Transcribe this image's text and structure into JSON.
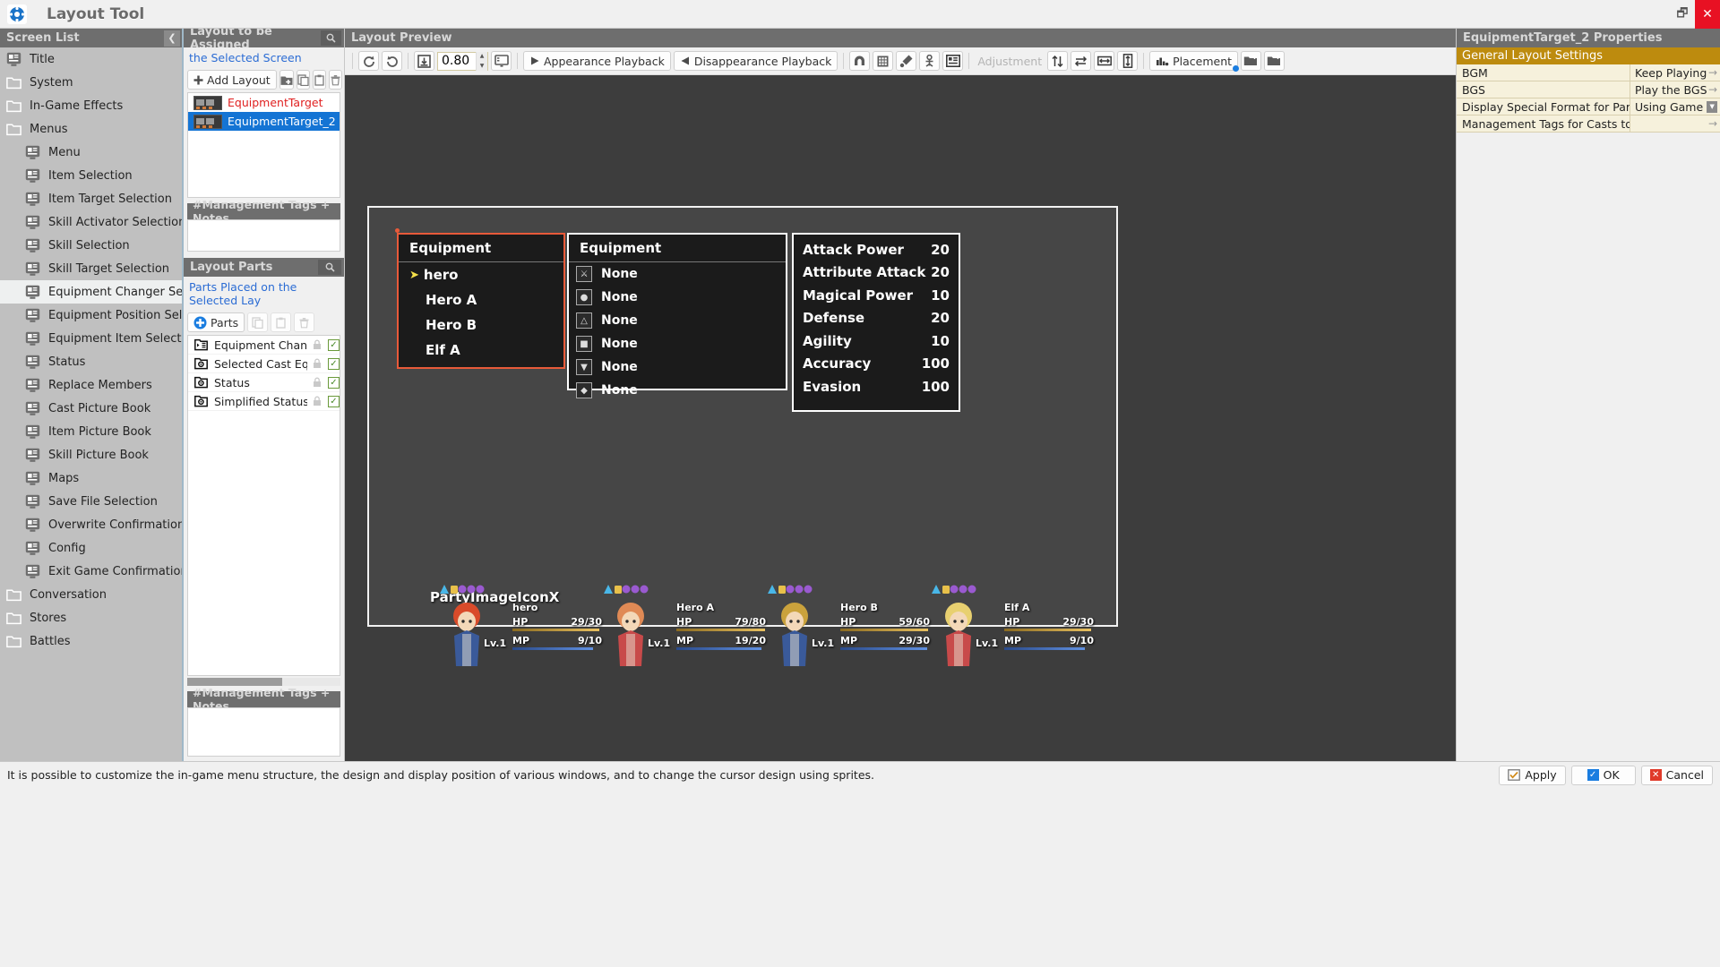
{
  "titlebar": {
    "title": "Layout Tool",
    "minimize": "🗗",
    "close": "✕"
  },
  "screen_list": {
    "header": "Screen List",
    "items": [
      {
        "label": "Title",
        "icon": "screen-icon",
        "indent": false,
        "selected": false
      },
      {
        "label": "System",
        "icon": "folder-icon",
        "indent": false,
        "selected": false
      },
      {
        "label": "In-Game Effects",
        "icon": "folder-icon",
        "indent": false,
        "selected": false
      },
      {
        "label": "Menus",
        "icon": "folder-icon",
        "indent": false,
        "selected": false
      },
      {
        "label": "Menu",
        "icon": "screen-icon",
        "indent": true,
        "selected": false
      },
      {
        "label": "Item Selection",
        "icon": "screen-icon",
        "indent": true,
        "selected": false
      },
      {
        "label": "Item Target Selection",
        "icon": "screen-icon",
        "indent": true,
        "selected": false
      },
      {
        "label": "Skill Activator Selection",
        "icon": "screen-icon",
        "indent": true,
        "selected": false
      },
      {
        "label": "Skill Selection",
        "icon": "screen-icon",
        "indent": true,
        "selected": false
      },
      {
        "label": "Skill Target Selection",
        "icon": "screen-icon",
        "indent": true,
        "selected": false
      },
      {
        "label": "Equipment Changer Selection",
        "icon": "screen-icon",
        "indent": true,
        "selected": true
      },
      {
        "label": "Equipment Position Selection",
        "icon": "screen-icon",
        "indent": true,
        "selected": false
      },
      {
        "label": "Equipment Item Selection",
        "icon": "screen-icon",
        "indent": true,
        "selected": false
      },
      {
        "label": "Status",
        "icon": "screen-icon",
        "indent": true,
        "selected": false
      },
      {
        "label": "Replace Members",
        "icon": "screen-icon",
        "indent": true,
        "selected": false
      },
      {
        "label": "Cast Picture Book",
        "icon": "screen-icon",
        "indent": true,
        "selected": false
      },
      {
        "label": "Item Picture Book",
        "icon": "screen-icon",
        "indent": true,
        "selected": false
      },
      {
        "label": "Skill Picture Book",
        "icon": "screen-icon",
        "indent": true,
        "selected": false
      },
      {
        "label": "Maps",
        "icon": "screen-icon",
        "indent": true,
        "selected": false
      },
      {
        "label": "Save File Selection",
        "icon": "screen-icon",
        "indent": true,
        "selected": false
      },
      {
        "label": "Overwrite Confirmation",
        "icon": "screen-icon",
        "indent": true,
        "selected": false
      },
      {
        "label": "Config",
        "icon": "screen-icon",
        "indent": true,
        "selected": false
      },
      {
        "label": "Exit Game Confirmation",
        "icon": "screen-icon",
        "indent": true,
        "selected": false
      },
      {
        "label": "Conversation",
        "icon": "folder-icon",
        "indent": false,
        "selected": false
      },
      {
        "label": "Stores",
        "icon": "folder-icon",
        "indent": false,
        "selected": false
      },
      {
        "label": "Battles",
        "icon": "folder-icon",
        "indent": false,
        "selected": false
      }
    ]
  },
  "layout_panel": {
    "header": "Layout to be Assigned",
    "subtitle": "the Selected Screen",
    "add_layout_label": "Add Layout",
    "layouts": [
      {
        "name": "EquipmentTarget",
        "selected": false
      },
      {
        "name": "EquipmentTarget_2",
        "selected": true
      }
    ],
    "mgmt_header": "#Management Tags + Notes",
    "mgmt_value": ""
  },
  "parts_panel": {
    "header": "Layout Parts",
    "subtitle": "Parts Placed on the Selected Lay",
    "parts_button": "Parts",
    "items": [
      {
        "name": "Equipment Chan...",
        "locked": true,
        "visible": true
      },
      {
        "name": "Selected Cast Eq...",
        "locked": true,
        "visible": true
      },
      {
        "name": "Status",
        "locked": true,
        "visible": true
      },
      {
        "name": "Simplified Status",
        "locked": true,
        "visible": true
      }
    ],
    "mgmt_header": "#Management Tags + Notes",
    "mgmt_value": ""
  },
  "preview": {
    "header": "Layout Preview",
    "zoom_value": "0.80",
    "appearance_playback": "Appearance Playback",
    "disappearance_playback": "Disappearance Playback",
    "adjustment_label": "Adjustment",
    "placement_label": "Placement"
  },
  "game": {
    "equipment_menu": {
      "title": "Equipment",
      "entries": [
        {
          "label": "hero",
          "cursor": true
        },
        {
          "label": "Hero A",
          "cursor": false
        },
        {
          "label": "Hero B",
          "cursor": false
        },
        {
          "label": "Elf A",
          "cursor": false
        }
      ]
    },
    "equipment_slots": {
      "title": "Equipment",
      "slots": [
        {
          "icon": "weapon-icon",
          "value": "None"
        },
        {
          "icon": "shield-icon",
          "value": "None"
        },
        {
          "icon": "helmet-icon",
          "value": "None"
        },
        {
          "icon": "armor-icon",
          "value": "None"
        },
        {
          "icon": "boots-icon",
          "value": "None"
        },
        {
          "icon": "accessory-icon",
          "value": "None"
        }
      ]
    },
    "stats": [
      {
        "label": "Attack Power",
        "value": "20"
      },
      {
        "label": "Attribute Attack",
        "value": "20"
      },
      {
        "label": "Magical Power",
        "value": "10"
      },
      {
        "label": "Defense",
        "value": "20"
      },
      {
        "label": "Agility",
        "value": "10"
      },
      {
        "label": "Accuracy",
        "value": "100"
      },
      {
        "label": "Evasion",
        "value": "100"
      }
    ],
    "party_label": "PartyImageIconX",
    "party": [
      {
        "name": "hero",
        "hp_label": "HP",
        "hp": "29/30",
        "mp_label": "MP",
        "mp": "9/10",
        "lv": "Lv.1",
        "hp_pct": 97,
        "mp_pct": 90,
        "hair": "#d94b2a",
        "sprite": "hero-sprite"
      },
      {
        "name": "Hero A",
        "hp_label": "HP",
        "hp": "79/80",
        "mp_label": "MP",
        "mp": "19/20",
        "lv": "Lv.1",
        "hp_pct": 99,
        "mp_pct": 95,
        "hair": "#e08a55",
        "sprite": "heroa-sprite"
      },
      {
        "name": "Hero B",
        "hp_label": "HP",
        "hp": "59/60",
        "mp_label": "MP",
        "mp": "29/30",
        "lv": "Lv.1",
        "hp_pct": 98,
        "mp_pct": 97,
        "hair": "#caa23c",
        "sprite": "herob-sprite"
      },
      {
        "name": "Elf A",
        "hp_label": "HP",
        "hp": "29/30",
        "mp_label": "MP",
        "mp": "9/10",
        "lv": "Lv.1",
        "hp_pct": 97,
        "mp_pct": 90,
        "hair": "#e8d070",
        "sprite": "elfa-sprite"
      }
    ]
  },
  "properties": {
    "header": "EquipmentTarget_2 Properties",
    "section": "General Layout Settings",
    "rows": [
      {
        "key": "BGM",
        "value": "Keep Playing ..",
        "control": "arrow"
      },
      {
        "key": "BGS",
        "value": "Play the BGS ..",
        "control": "arrow"
      },
      {
        "key": "Display Special Format for Party",
        "value": "Using Game ..",
        "control": "dropdown"
      },
      {
        "key": "Management Tags for Casts to be ...",
        "value": "",
        "control": "arrow"
      }
    ]
  },
  "statusbar": {
    "message": "It is possible to customize the in-game menu structure, the design and display position of various windows, and to change the cursor design using sprites.",
    "apply": "Apply",
    "ok": "OK",
    "cancel": "Cancel"
  },
  "colors": {
    "accent": "#1474d4",
    "gold": "#bd8b0e",
    "danger": "#e81123",
    "link": "#2b6cd4"
  }
}
